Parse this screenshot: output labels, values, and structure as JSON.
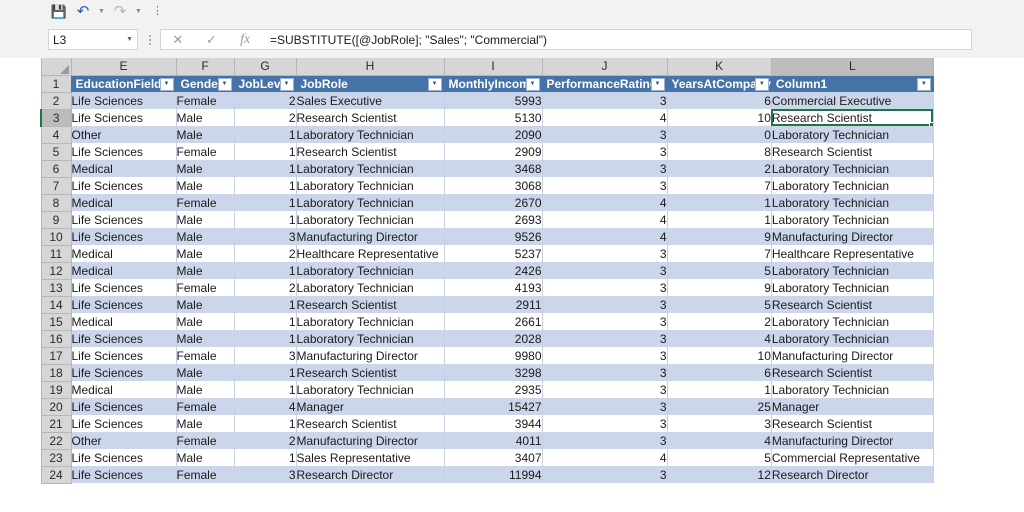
{
  "quick_access": {
    "items": [
      {
        "name": "save",
        "glyph": "💾",
        "label": "Save"
      },
      {
        "name": "undo",
        "glyph": "↶",
        "label": "Undo"
      },
      {
        "name": "redo",
        "glyph": "↷",
        "label": "Redo"
      },
      {
        "name": "customize",
        "glyph": "⫶",
        "label": "Customize Quick Access Toolbar"
      }
    ]
  },
  "formula_bar": {
    "name_box_value": "L3",
    "cancel_label": "✕",
    "enter_label": "✓",
    "fx_label": "fx",
    "formula": "=SUBSTITUTE([@JobRole]; \"Sales\"; \"Commercial\")"
  },
  "grid": {
    "column_letters": [
      "E",
      "F",
      "G",
      "H",
      "I",
      "J",
      "K",
      "L"
    ],
    "active_column": "L",
    "active_row": "3",
    "selected_cell": "L3",
    "headers": [
      "EducationField",
      "Gender",
      "JobLevel",
      "JobRole",
      "MonthlyIncome",
      "PerformanceRating",
      "YearsAtCompany",
      "Column1"
    ],
    "filter_glyph": "▼",
    "row_numbers": [
      "1",
      "2",
      "3",
      "4",
      "5",
      "6",
      "7",
      "8",
      "9",
      "10",
      "11",
      "12",
      "13",
      "14",
      "15",
      "16",
      "17",
      "18",
      "19",
      "20",
      "21",
      "22",
      "23",
      "24"
    ],
    "rows": [
      [
        "Life Sciences",
        "Female",
        "2",
        "Sales Executive",
        "5993",
        "3",
        "6",
        "Commercial Executive"
      ],
      [
        "Life Sciences",
        "Male",
        "2",
        "Research Scientist",
        "5130",
        "4",
        "10",
        "Research Scientist"
      ],
      [
        "Other",
        "Male",
        "1",
        "Laboratory Technician",
        "2090",
        "3",
        "0",
        "Laboratory Technician"
      ],
      [
        "Life Sciences",
        "Female",
        "1",
        "Research Scientist",
        "2909",
        "3",
        "8",
        "Research Scientist"
      ],
      [
        "Medical",
        "Male",
        "1",
        "Laboratory Technician",
        "3468",
        "3",
        "2",
        "Laboratory Technician"
      ],
      [
        "Life Sciences",
        "Male",
        "1",
        "Laboratory Technician",
        "3068",
        "3",
        "7",
        "Laboratory Technician"
      ],
      [
        "Medical",
        "Female",
        "1",
        "Laboratory Technician",
        "2670",
        "4",
        "1",
        "Laboratory Technician"
      ],
      [
        "Life Sciences",
        "Male",
        "1",
        "Laboratory Technician",
        "2693",
        "4",
        "1",
        "Laboratory Technician"
      ],
      [
        "Life Sciences",
        "Male",
        "3",
        "Manufacturing Director",
        "9526",
        "4",
        "9",
        "Manufacturing Director"
      ],
      [
        "Medical",
        "Male",
        "2",
        "Healthcare Representative",
        "5237",
        "3",
        "7",
        "Healthcare Representative"
      ],
      [
        "Medical",
        "Male",
        "1",
        "Laboratory Technician",
        "2426",
        "3",
        "5",
        "Laboratory Technician"
      ],
      [
        "Life Sciences",
        "Female",
        "2",
        "Laboratory Technician",
        "4193",
        "3",
        "9",
        "Laboratory Technician"
      ],
      [
        "Life Sciences",
        "Male",
        "1",
        "Research Scientist",
        "2911",
        "3",
        "5",
        "Research Scientist"
      ],
      [
        "Medical",
        "Male",
        "1",
        "Laboratory Technician",
        "2661",
        "3",
        "2",
        "Laboratory Technician"
      ],
      [
        "Life Sciences",
        "Male",
        "1",
        "Laboratory Technician",
        "2028",
        "3",
        "4",
        "Laboratory Technician"
      ],
      [
        "Life Sciences",
        "Female",
        "3",
        "Manufacturing Director",
        "9980",
        "3",
        "10",
        "Manufacturing Director"
      ],
      [
        "Life Sciences",
        "Male",
        "1",
        "Research Scientist",
        "3298",
        "3",
        "6",
        "Research Scientist"
      ],
      [
        "Medical",
        "Male",
        "1",
        "Laboratory Technician",
        "2935",
        "3",
        "1",
        "Laboratory Technician"
      ],
      [
        "Life Sciences",
        "Female",
        "4",
        "Manager",
        "15427",
        "3",
        "25",
        "Manager"
      ],
      [
        "Life Sciences",
        "Male",
        "1",
        "Research Scientist",
        "3944",
        "3",
        "3",
        "Research Scientist"
      ],
      [
        "Other",
        "Female",
        "2",
        "Manufacturing Director",
        "4011",
        "3",
        "4",
        "Manufacturing Director"
      ],
      [
        "Life Sciences",
        "Male",
        "1",
        "Sales Representative",
        "3407",
        "4",
        "5",
        "Commercial Representative"
      ],
      [
        "Life Sciences",
        "Female",
        "3",
        "Research Director",
        "11994",
        "3",
        "12",
        "Research Director"
      ]
    ]
  },
  "colors": {
    "table_header_blue": "#4573a7",
    "band_blue": "#ccd6ea",
    "selection_green": "#217346",
    "gutter_gray": "#d6d6d6"
  }
}
